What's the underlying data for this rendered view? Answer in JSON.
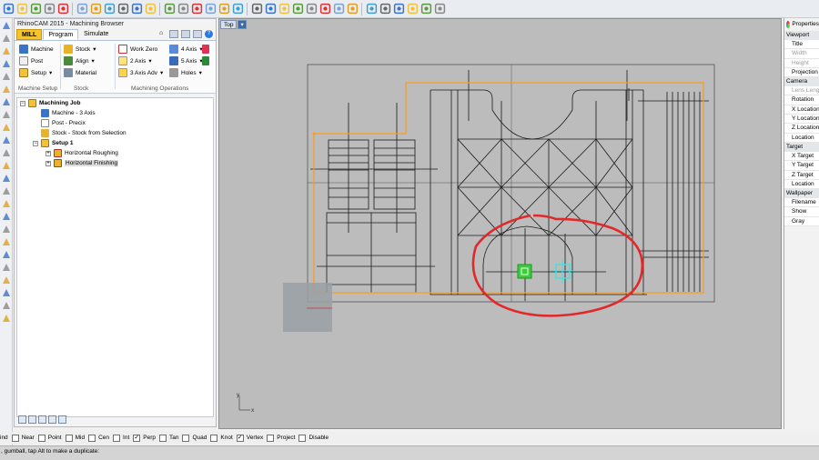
{
  "toolbar": {
    "icons": [
      "new-icon",
      "open-icon",
      "save-icon",
      "print-icon",
      "cut-icon",
      "copy-icon",
      "paste-icon",
      "undo-icon",
      "redo-icon",
      "pan-icon",
      "move-icon",
      "zoom-icon",
      "zoom-window-icon",
      "zoom-extents-icon",
      "zoom-selected-icon",
      "four-views-icon",
      "cplane-icon",
      "point-icon",
      "curve-icon",
      "circle-icon",
      "surface-icon",
      "mesh-icon",
      "light-icon",
      "gumball-icon",
      "render-icon",
      "shade-icon",
      "sphere-icon",
      "globe-icon",
      "snap-icon",
      "tools-icon",
      "layer-icon"
    ]
  },
  "browser": {
    "title": "RhinoCAM 2015 - Machining Browser",
    "tabs": {
      "mill": "MILL",
      "program": "Program",
      "simulate": "Simulate"
    },
    "ribbon": {
      "machine": "Machine",
      "post": "Post",
      "setup": "Setup",
      "stock": "Stock",
      "align": "Align",
      "material": "Material",
      "work_zero": "Work Zero",
      "two_axis": "2 Axis",
      "three_axis_adv": "3 Axis Adv",
      "four_axis": "4 Axis",
      "five_axis": "5 Axis",
      "holes": "Holes",
      "group_machine_setup": "Machine Setup",
      "group_stock": "Stock",
      "group_machining_ops": "Machining Operations"
    },
    "tree": {
      "root": "Machining Job",
      "machine": "Machine - 3 Axis",
      "post": "Post - Precix",
      "stock": "Stock - Stock from Selection",
      "setup": "Setup 1",
      "op1": "Horizontal Roughing",
      "op2": "Horizontal Finishing"
    }
  },
  "viewport": {
    "label": "Top",
    "axis_y": "y",
    "axis_x": "x"
  },
  "properties": {
    "title": "Properties",
    "sections": [
      {
        "name": "Viewport",
        "rows": [
          {
            "label": "Title",
            "disabled": false
          },
          {
            "label": "Width",
            "disabled": true
          },
          {
            "label": "Height",
            "disabled": true
          },
          {
            "label": "Projection",
            "disabled": false
          }
        ]
      },
      {
        "name": "Camera",
        "rows": [
          {
            "label": "Lens Length",
            "disabled": true
          },
          {
            "label": "Rotation",
            "disabled": false
          },
          {
            "label": "X Location",
            "disabled": false
          },
          {
            "label": "Y Location",
            "disabled": false
          },
          {
            "label": "Z Location",
            "disabled": false
          },
          {
            "label": "Location",
            "disabled": false
          }
        ]
      },
      {
        "name": "Target",
        "rows": [
          {
            "label": "X Target",
            "disabled": false
          },
          {
            "label": "Y Target",
            "disabled": false
          },
          {
            "label": "Z Target",
            "disabled": false
          },
          {
            "label": "Location",
            "disabled": false
          }
        ]
      },
      {
        "name": "Wallpaper",
        "rows": [
          {
            "label": "Filename",
            "disabled": false
          },
          {
            "label": "Show",
            "disabled": false
          },
          {
            "label": "Gray",
            "disabled": false
          }
        ]
      }
    ]
  },
  "osnap": {
    "label": "ind",
    "items": [
      {
        "label": "Near",
        "checked": false
      },
      {
        "label": "Point",
        "checked": false
      },
      {
        "label": "Mid",
        "checked": false
      },
      {
        "label": "Cen",
        "checked": false
      },
      {
        "label": "Int",
        "checked": false
      },
      {
        "label": "Perp",
        "checked": true
      },
      {
        "label": "Tan",
        "checked": false
      },
      {
        "label": "Quad",
        "checked": false
      },
      {
        "label": "Knot",
        "checked": false
      },
      {
        "label": "Vertex",
        "checked": true
      },
      {
        "label": "Project",
        "checked": false
      },
      {
        "label": "Disable",
        "checked": false
      }
    ]
  },
  "command_line": ", gumball, tap Alt to make a duplicate:",
  "colors": {
    "viewport_bg": "#bcbcbc",
    "stock_outline": "#ff9a1a",
    "annotation": "#e3282a",
    "gumball_green": "#3ccc3c",
    "gumball_cyan": "#3fe0e0",
    "mill_tab": "#f4c430"
  }
}
